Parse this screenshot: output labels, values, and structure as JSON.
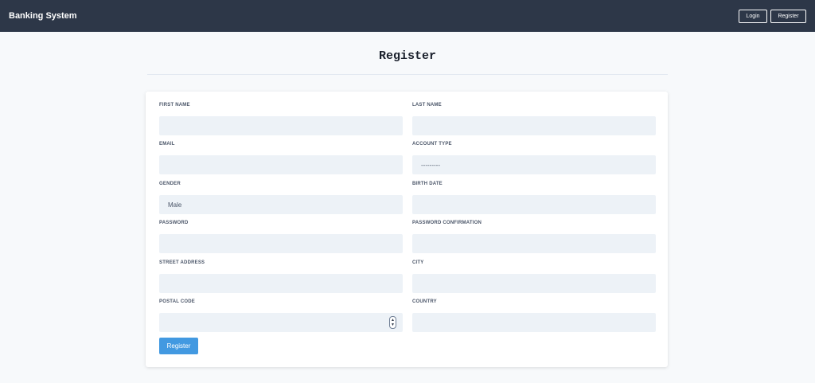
{
  "navbar": {
    "brand": "Banking System",
    "login_label": "Login",
    "register_label": "Register"
  },
  "page": {
    "title": "Register"
  },
  "form": {
    "first_name": {
      "label": "FIRST NAME",
      "value": ""
    },
    "last_name": {
      "label": "LAST NAME",
      "value": ""
    },
    "email": {
      "label": "EMAIL",
      "value": ""
    },
    "account_type": {
      "label": "ACCOUNT TYPE",
      "value": "---------"
    },
    "gender": {
      "label": "GENDER",
      "value": "Male"
    },
    "birth_date": {
      "label": "BIRTH DATE",
      "value": ""
    },
    "password": {
      "label": "PASSWORD",
      "value": ""
    },
    "password_confirmation": {
      "label": "PASSWORD CONFIRMATION",
      "value": ""
    },
    "street_address": {
      "label": "STREET ADDRESS",
      "value": ""
    },
    "city": {
      "label": "CITY",
      "value": ""
    },
    "postal_code": {
      "label": "POSTAL CODE",
      "value": ""
    },
    "country": {
      "label": "COUNTRY",
      "value": ""
    },
    "submit_label": "Register"
  },
  "icons": {
    "stepper_up": "▲",
    "stepper_down": "▼"
  }
}
